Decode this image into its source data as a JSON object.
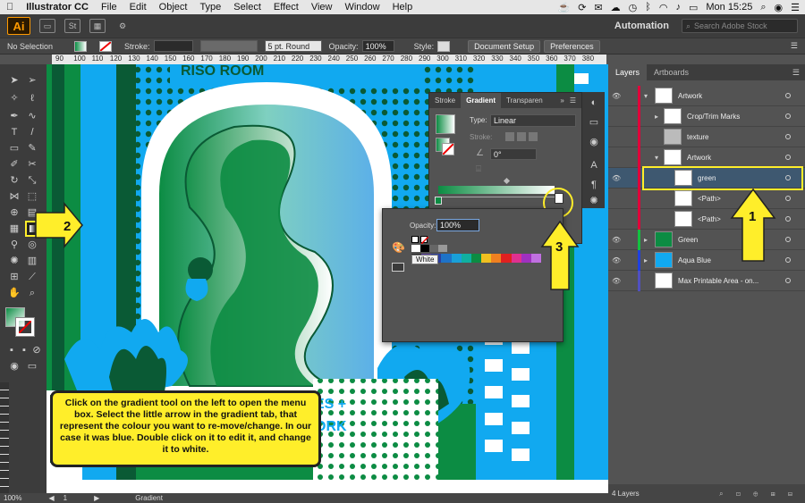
{
  "menubar": {
    "app_name": "Illustrator CC",
    "items": [
      "File",
      "Edit",
      "Object",
      "Type",
      "Select",
      "Effect",
      "View",
      "Window",
      "Help"
    ],
    "clock": "Mon 15:25"
  },
  "appbar": {
    "logo": "Ai",
    "st_label": "St",
    "workspace": "Automation",
    "stock_placeholder": "Search Adobe Stock"
  },
  "control": {
    "selection": "No Selection",
    "stroke_label": "Stroke:",
    "brush": "5 pt. Round",
    "opacity_label": "Opacity:",
    "opacity_value": "100%",
    "style_label": "Style:",
    "doc_setup": "Document Setup",
    "preferences": "Preferences"
  },
  "ruler": {
    "ticks": [
      "90",
      "100",
      "110",
      "120",
      "130",
      "140",
      "150",
      "160",
      "170",
      "180",
      "190",
      "200",
      "210",
      "220",
      "230",
      "240",
      "250",
      "260",
      "270",
      "280",
      "290",
      "300",
      "310",
      "320",
      "330",
      "340",
      "350",
      "360",
      "370",
      "380"
    ]
  },
  "artwork": {
    "header_text": "RISO ROOM",
    "bottom_text": [
      "ES +",
      "ORK"
    ]
  },
  "gradient_panel": {
    "tabs": [
      "Stroke",
      "Gradient",
      "Transparen"
    ],
    "type_label": "Type:",
    "type_value": "Linear",
    "stroke_label": "Stroke:",
    "angle_value": "0°"
  },
  "opacity_popup": {
    "opacity_label": "Opacity:",
    "opacity_value": "100%",
    "tooltip": "White"
  },
  "layers_panel": {
    "tabs": [
      "Layers",
      "Artboards"
    ],
    "rows": [
      {
        "name": "Artwork"
      },
      {
        "name": "Crop/Trim Marks"
      },
      {
        "name": "texture"
      },
      {
        "name": "Artwork"
      },
      {
        "name": "green"
      },
      {
        "name": "<Path>"
      },
      {
        "name": "<Path>"
      },
      {
        "name": "Green"
      },
      {
        "name": "Aqua Blue"
      },
      {
        "name": "Max Printable Area - on..."
      }
    ],
    "footer": "4 Layers"
  },
  "status": {
    "zoom": "100%",
    "artboard": "1",
    "tool": "Gradient"
  },
  "callouts": {
    "one": "1",
    "two": "2",
    "three": "3",
    "instruction": "Click on the gradient tool on the left to open the menu box. Select the little arrow in the gradient tab, that represent the colour you want to re-move/change. In our case it was blue. Double click on it to edit it, and change it to white."
  },
  "colors": {
    "highlight_yellow": "#ffee2a",
    "art_blue": "#11a9f0",
    "art_green": "#0c8c43",
    "dark_green": "#0a5a35",
    "selected_row": "#3e5870"
  }
}
